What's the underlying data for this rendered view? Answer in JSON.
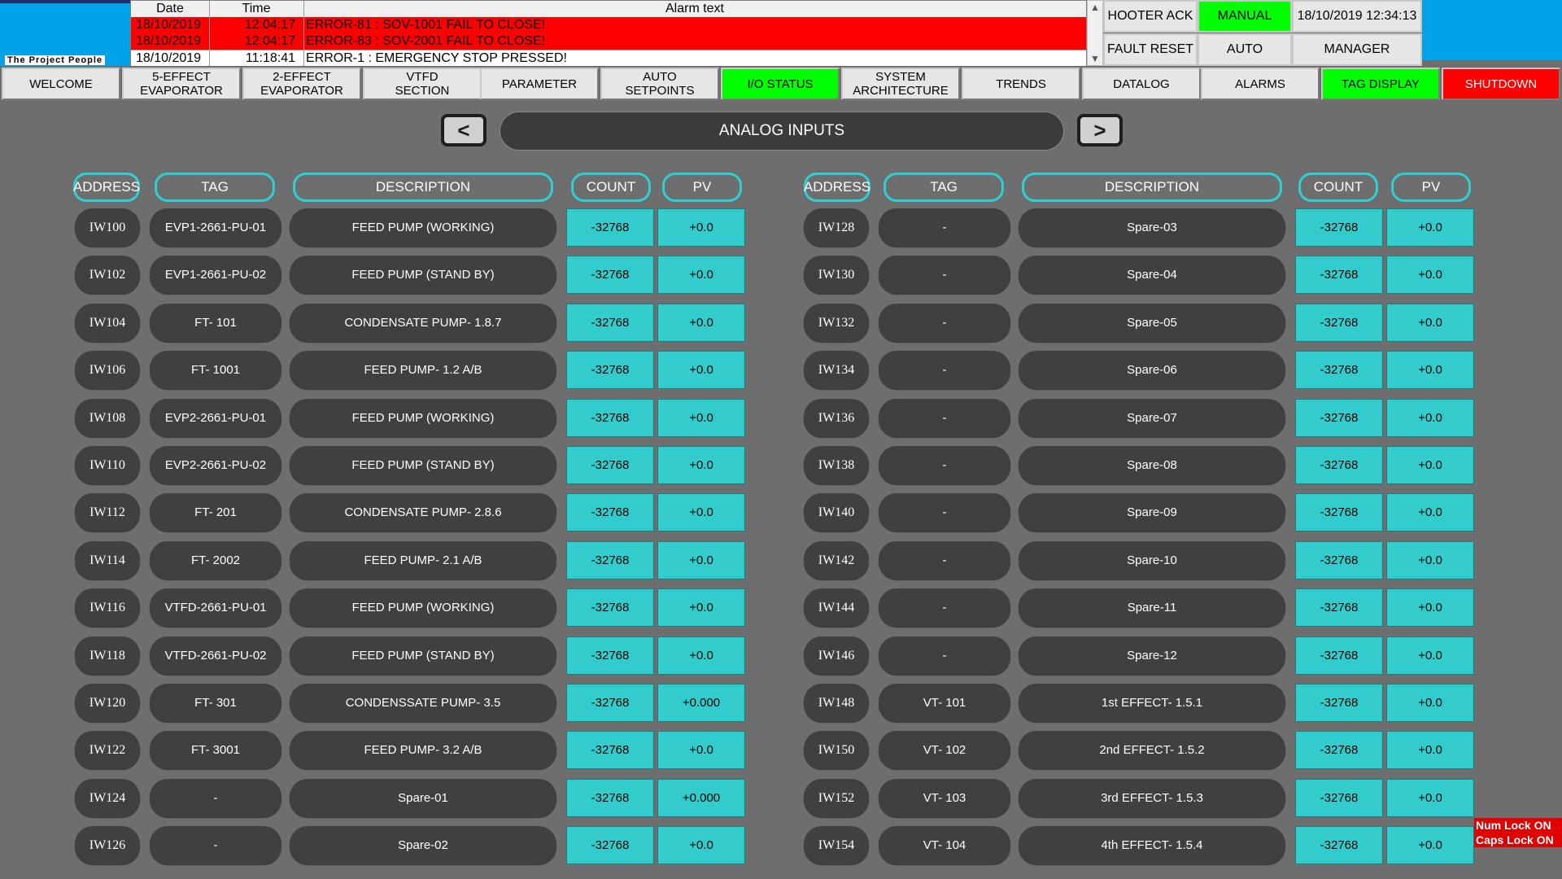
{
  "logo": {
    "text": "The Project  People"
  },
  "alarm_table": {
    "headers": {
      "date": "Date",
      "time": "Time",
      "text": "Alarm text"
    },
    "rows": [
      {
        "date": "18/10/2019",
        "time": "12:04:17",
        "text": "ERROR-81 : SOV-1001 FAIL TO CLOSE!",
        "state": "active"
      },
      {
        "date": "18/10/2019",
        "time": "12:04:17",
        "text": "ERROR-83 : SOV-2001 FAIL TO CLOSE!",
        "state": "active"
      },
      {
        "date": "18/10/2019",
        "time": "11:18:41",
        "text": "ERROR-1 : EMERGENCY STOP PRESSED!",
        "state": "normal"
      }
    ]
  },
  "top_controls": {
    "hooter_ack": "HOOTER ACK",
    "fault_reset": "FAULT RESET",
    "manual": "MANUAL",
    "auto": "AUTO",
    "datetime": "18/10/2019 12:34:13",
    "user": "MANAGER"
  },
  "nav": [
    {
      "label": "WELCOME",
      "state": "normal"
    },
    {
      "label": "5-EFFECT\nEVAPORATOR",
      "state": "normal"
    },
    {
      "label": "2-EFFECT\nEVAPORATOR",
      "state": "normal"
    },
    {
      "label": "VTFD\nSECTION",
      "state": "normal"
    },
    {
      "label": "PARAMETER",
      "state": "normal"
    },
    {
      "label": "AUTO\nSETPOINTS",
      "state": "normal"
    },
    {
      "label": "I/O STATUS",
      "state": "active"
    },
    {
      "label": "SYSTEM\nARCHITECTURE",
      "state": "normal"
    },
    {
      "label": "TRENDS",
      "state": "normal"
    },
    {
      "label": "DATALOG",
      "state": "normal"
    },
    {
      "label": "ALARMS",
      "state": "normal"
    },
    {
      "label": "TAG DISPLAY",
      "state": "active"
    },
    {
      "label": "SHUTDOWN",
      "state": "danger"
    }
  ],
  "page": {
    "title": "ANALOG INPUTS",
    "prev_icon": "chevron-left-icon",
    "next_icon": "chevron-right-icon"
  },
  "columns": {
    "address": "ADDRESS",
    "tag": "TAG",
    "description": "DESCRIPTION",
    "count": "COUNT",
    "pv": "PV"
  },
  "left_rows": [
    {
      "address": "IW100",
      "tag": "EVP1-2661-PU-01",
      "description": "FEED PUMP (WORKING)",
      "count": "-32768",
      "pv": "+0.0"
    },
    {
      "address": "IW102",
      "tag": "EVP1-2661-PU-02",
      "description": "FEED PUMP (STAND BY)",
      "count": "-32768",
      "pv": "+0.0"
    },
    {
      "address": "IW104",
      "tag": "FT- 101",
      "description": "CONDENSATE PUMP- 1.8.7",
      "count": "-32768",
      "pv": "+0.0"
    },
    {
      "address": "IW106",
      "tag": "FT- 1001",
      "description": "FEED PUMP- 1.2 A/B",
      "count": "-32768",
      "pv": "+0.0"
    },
    {
      "address": "IW108",
      "tag": "EVP2-2661-PU-01",
      "description": "FEED PUMP (WORKING)",
      "count": "-32768",
      "pv": "+0.0"
    },
    {
      "address": "IW110",
      "tag": "EVP2-2661-PU-02",
      "description": "FEED PUMP (STAND BY)",
      "count": "-32768",
      "pv": "+0.0"
    },
    {
      "address": "IW112",
      "tag": "FT- 201",
      "description": "CONDENSATE PUMP- 2.8.6",
      "count": "-32768",
      "pv": "+0.0"
    },
    {
      "address": "IW114",
      "tag": "FT- 2002",
      "description": "FEED PUMP- 2.1 A/B",
      "count": "-32768",
      "pv": "+0.0"
    },
    {
      "address": "IW116",
      "tag": "VTFD-2661-PU-01",
      "description": "FEED PUMP (WORKING)",
      "count": "-32768",
      "pv": "+0.0"
    },
    {
      "address": "IW118",
      "tag": "VTFD-2661-PU-02",
      "description": "FEED PUMP (STAND BY)",
      "count": "-32768",
      "pv": "+0.0"
    },
    {
      "address": "IW120",
      "tag": "FT- 301",
      "description": "CONDENSSATE PUMP- 3.5",
      "count": "-32768",
      "pv": "+0.000"
    },
    {
      "address": "IW122",
      "tag": "FT- 3001",
      "description": "FEED PUMP- 3.2 A/B",
      "count": "-32768",
      "pv": "+0.0"
    },
    {
      "address": "IW124",
      "tag": "-",
      "description": "Spare-01",
      "count": "-32768",
      "pv": "+0.000"
    },
    {
      "address": "IW126",
      "tag": "-",
      "description": "Spare-02",
      "count": "-32768",
      "pv": "+0.0"
    }
  ],
  "right_rows": [
    {
      "address": "IW128",
      "tag": "-",
      "description": "Spare-03",
      "count": "-32768",
      "pv": "+0.0"
    },
    {
      "address": "IW130",
      "tag": "-",
      "description": "Spare-04",
      "count": "-32768",
      "pv": "+0.0"
    },
    {
      "address": "IW132",
      "tag": "-",
      "description": "Spare-05",
      "count": "-32768",
      "pv": "+0.0"
    },
    {
      "address": "IW134",
      "tag": "-",
      "description": "Spare-06",
      "count": "-32768",
      "pv": "+0.0"
    },
    {
      "address": "IW136",
      "tag": "-",
      "description": "Spare-07",
      "count": "-32768",
      "pv": "+0.0"
    },
    {
      "address": "IW138",
      "tag": "-",
      "description": "Spare-08",
      "count": "-32768",
      "pv": "+0.0"
    },
    {
      "address": "IW140",
      "tag": "-",
      "description": "Spare-09",
      "count": "-32768",
      "pv": "+0.0"
    },
    {
      "address": "IW142",
      "tag": "-",
      "description": "Spare-10",
      "count": "-32768",
      "pv": "+0.0"
    },
    {
      "address": "IW144",
      "tag": "-",
      "description": "Spare-11",
      "count": "-32768",
      "pv": "+0.0"
    },
    {
      "address": "IW146",
      "tag": "-",
      "description": "Spare-12",
      "count": "-32768",
      "pv": "+0.0"
    },
    {
      "address": "IW148",
      "tag": "VT- 101",
      "description": "1st EFFECT- 1.5.1",
      "count": "-32768",
      "pv": "+0.0"
    },
    {
      "address": "IW150",
      "tag": "VT- 102",
      "description": "2nd EFFECT- 1.5.2",
      "count": "-32768",
      "pv": "+0.0"
    },
    {
      "address": "IW152",
      "tag": "VT- 103",
      "description": "3rd EFFECT- 1.5.3",
      "count": "-32768",
      "pv": "+0.0"
    },
    {
      "address": "IW154",
      "tag": "VT- 104",
      "description": "4th EFFECT- 1.5.4",
      "count": "-32768",
      "pv": "+0.0"
    }
  ],
  "lock_status": {
    "num": "Num Lock ON",
    "caps": "Caps Lock ON"
  },
  "colors": {
    "cyan": "#33cccc",
    "active": "#00ff00",
    "danger": "#ff0000",
    "alarm": "#ff0000",
    "brand": "#00a3e8"
  }
}
